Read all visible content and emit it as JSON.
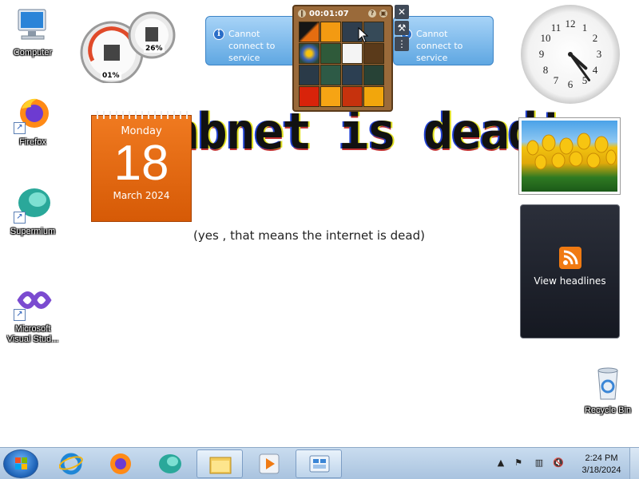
{
  "wallpaper": {
    "title": "abnet is dead!!",
    "subtitle": "(yes , that means the internet is dead)"
  },
  "desktop_icons": [
    {
      "label": "Computer",
      "icon": "computer-icon"
    },
    {
      "label": "Firefox",
      "icon": "firefox-icon"
    },
    {
      "label": "Supermium",
      "icon": "supermium-icon"
    },
    {
      "label": "Microsoft Visual Stud...",
      "icon": "visual-studio-icon"
    },
    {
      "label": "Recycle Bin",
      "icon": "recycle-bin-icon"
    }
  ],
  "gadgets": {
    "cpu_meter": {
      "cpu": "01%",
      "memory": "26%"
    },
    "service_left": {
      "message": "Cannot connect to service"
    },
    "service_right": {
      "message": "Cannot connect to service"
    },
    "puzzle": {
      "timer": "00:01:07"
    },
    "analog_clock": {
      "hour": 4,
      "minute": 24
    },
    "calendar": {
      "weekday": "Monday",
      "day": "18",
      "month_year": "March 2024"
    },
    "feed_headlines": {
      "label": "View headlines"
    }
  },
  "taskbar": {
    "pinned": [
      {
        "name": "internet-explorer",
        "active": false
      },
      {
        "name": "firefox",
        "active": false
      },
      {
        "name": "supermium",
        "active": false
      },
      {
        "name": "file-explorer",
        "active": true
      },
      {
        "name": "media-player",
        "active": false
      },
      {
        "name": "desktop-gadgets",
        "active": true
      }
    ],
    "clock": {
      "time": "2:24 PM",
      "date": "3/18/2024"
    }
  },
  "colors": {
    "taskbar": "#b9cfe7",
    "calendar": "#e66a10",
    "gadget_blue": "#5fa7e2"
  }
}
